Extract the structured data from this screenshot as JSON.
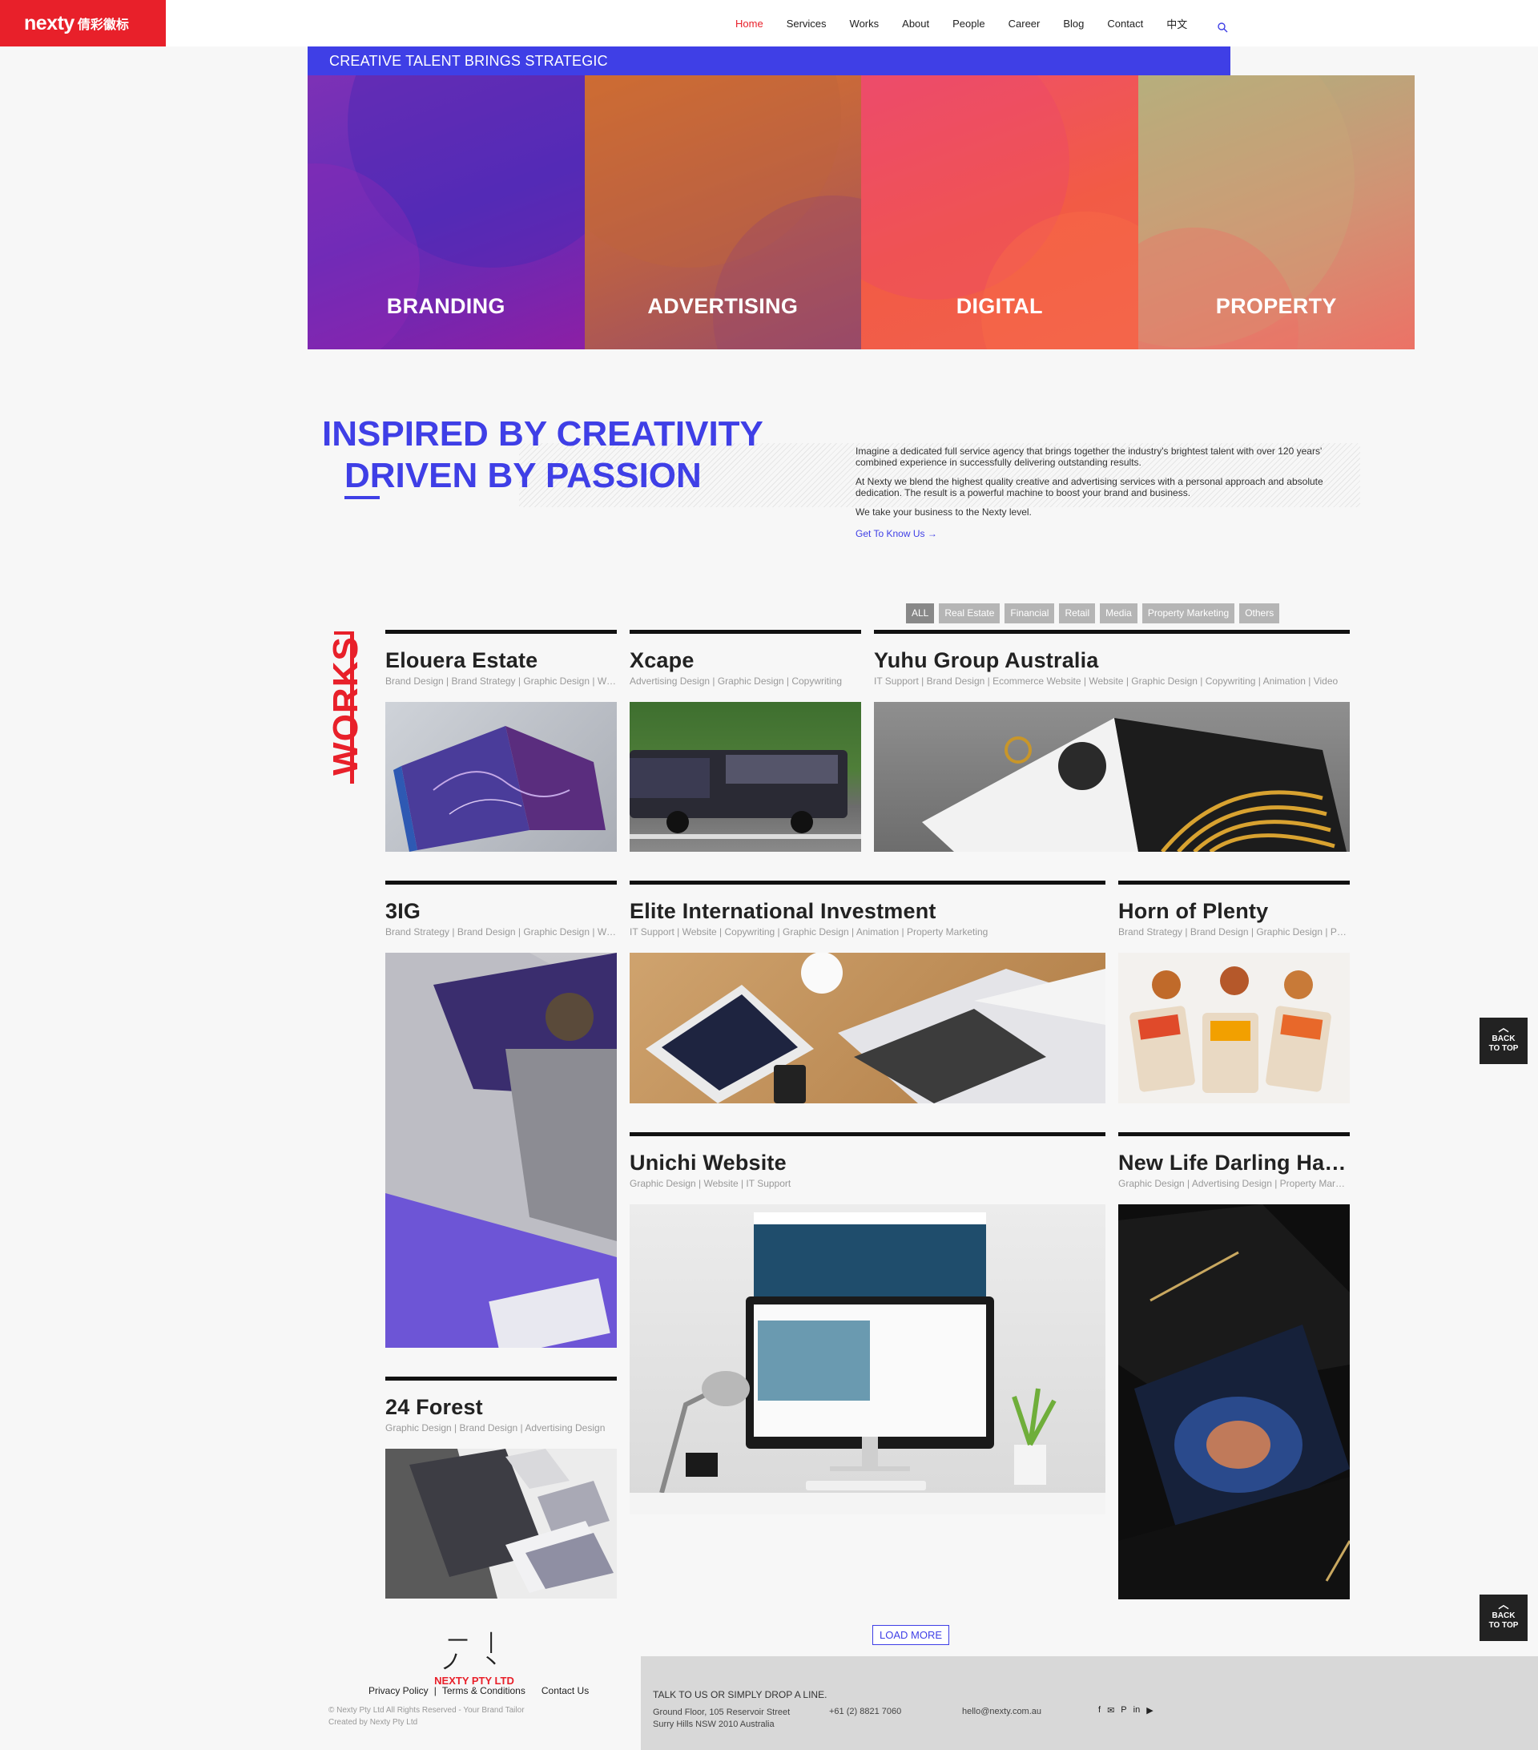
{
  "header": {
    "logo_en": "nexty",
    "logo_zh": "倩彩徽标",
    "nav": [
      "Home",
      "Services",
      "Works",
      "About",
      "People",
      "Career",
      "Blog",
      "Contact",
      "中文"
    ]
  },
  "hero": {
    "strip": "CREATIVE TALENT BRINGS STRATEGIC",
    "tiles": [
      "BRANDING",
      "ADVERTISING",
      "DIGITAL",
      "PROPERTY"
    ]
  },
  "intro": {
    "headline_1": "INSPIRED BY CREATIVITY",
    "headline_2": "DRIVEN BY PASSION",
    "p1": "Imagine a dedicated full service agency that brings together the industry's brightest talent with over 120 years' combined experience in successfully delivering outstanding results.",
    "p2": "At Nexty we blend the highest quality creative and advertising services with a personal approach and absolute dedication. The result is a powerful machine to boost your brand and business.",
    "p3": "We take your business to the Nexty level.",
    "link": "Get To Know Us →"
  },
  "works": {
    "label": "WORKS",
    "filters": [
      "ALL",
      "Real Estate",
      "Financial",
      "Retail",
      "Media",
      "Property Marketing",
      "Others"
    ],
    "items": [
      {
        "title": "Elouera Estate",
        "tags": "Brand Design | Brand Strategy | Graphic Design | Website"
      },
      {
        "title": "Xcape",
        "tags": "Advertising Design | Graphic Design | Copywriting"
      },
      {
        "title": "Yuhu Group Australia",
        "tags": "IT Support | Brand Design | Ecommerce Website | Website | Graphic Design | Copywriting | Animation | Video"
      },
      {
        "title": "3IG",
        "tags": "Brand Strategy | Brand Design | Graphic Design | Website"
      },
      {
        "title": "Elite International Investment",
        "tags": "IT Support | Website | Copywriting | Graphic Design | Animation | Property Marketing"
      },
      {
        "title": "Horn of Plenty",
        "tags": "Brand Strategy | Brand Design | Graphic Design | Packaging"
      },
      {
        "title": "Unichi Website",
        "tags": "Graphic Design | Website | IT Support"
      },
      {
        "title": "New Life Darling Harbour",
        "tags": "Graphic Design | Advertising Design | Property Marketing"
      },
      {
        "title": "24 Forest",
        "tags": "Graphic Design | Brand Design | Advertising Design"
      }
    ],
    "load_more": "LOAD MORE",
    "back_to_top_1": "BACK",
    "back_to_top_2": "TO TOP"
  },
  "footer": {
    "mark": "一 | ノ 丶",
    "company": "NEXTY PTY LTD",
    "privacy": "Privacy Policy",
    "sep": "|",
    "terms": "Terms & Conditions",
    "contact": "Contact Us",
    "copyright_1": "© Nexty Pty Ltd All Rights Reserved - Your Brand Tailor",
    "copyright_2": "Created by Nexty Pty Ltd",
    "drop_line": "TALK TO US OR SIMPLY DROP A LINE.",
    "address_1": "Ground Floor, 105 Reservoir Street",
    "address_2": "Surry Hills NSW 2010 Australia",
    "phone": "+61 (2) 8821 7060",
    "email": "hello@nexty.com.au",
    "social": [
      "f",
      "✉",
      "P",
      "in",
      "▶"
    ]
  },
  "colors": {
    "brand_red": "#e8202a",
    "accent_blue": "#3f3fe6"
  }
}
